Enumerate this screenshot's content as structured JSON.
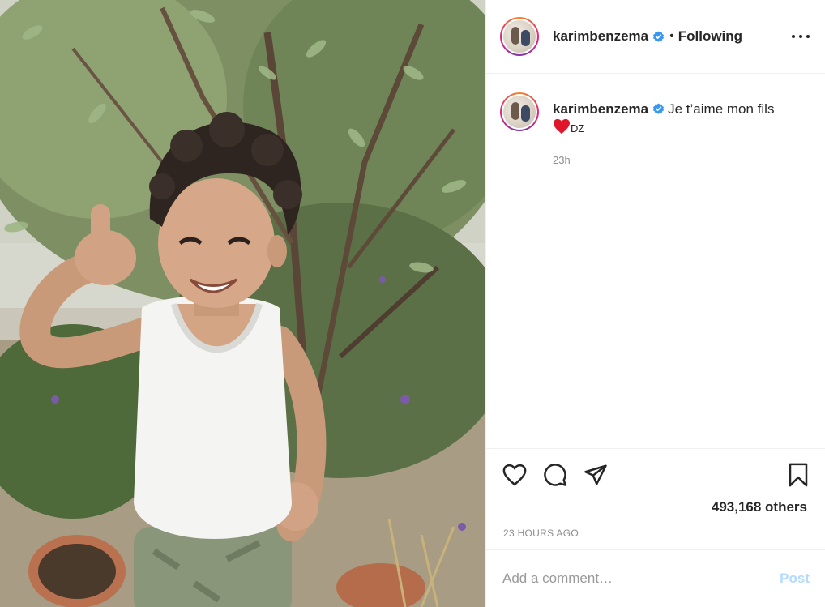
{
  "post": {
    "image_alt": "Child giving a thumbs up in front of a shrub",
    "author": {
      "username": "karimbenzema",
      "verified": true,
      "follow_state": "Following",
      "separator": "•"
    },
    "caption": {
      "username": "karimbenzema",
      "text": "Je t’aime mon fils",
      "suffix": "DZ",
      "age": "23h"
    },
    "likes_text": "493,168 others",
    "timestamp": "23 HOURS AGO",
    "comment": {
      "placeholder": "Add a comment…",
      "value": "",
      "post_label": "Post"
    },
    "icons": {
      "like": "heart-icon",
      "comment": "comment-icon",
      "share": "share-icon",
      "save": "bookmark-icon",
      "more": "more-options-icon",
      "verified": "verified-badge-icon"
    },
    "colors": {
      "verified": "#3897f0",
      "heart_emoji": "#e0162b",
      "post_disabled": "#b3dbff",
      "muted": "#8e8e8e"
    }
  }
}
